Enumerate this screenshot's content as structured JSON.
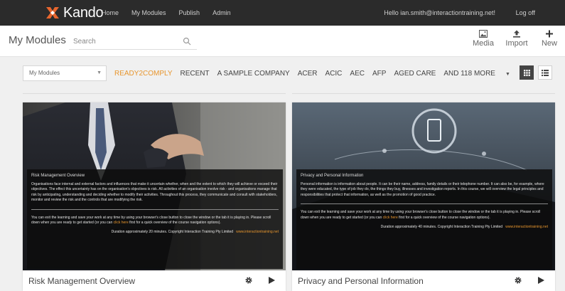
{
  "app": {
    "logo_text": "Kando",
    "nav": [
      "Home",
      "My Modules",
      "Publish",
      "Admin"
    ],
    "user_greeting": "Hello ian.smith@interactiontraining.net!",
    "logout": "Log off"
  },
  "header": {
    "title": "My Modules",
    "search_placeholder": "Search",
    "actions": [
      {
        "label": "Media",
        "icon": "image-icon"
      },
      {
        "label": "Import",
        "icon": "upload-icon"
      },
      {
        "label": "New",
        "icon": "plus-icon"
      }
    ]
  },
  "filters": {
    "dropdown_value": "My Modules",
    "tags": [
      "READY2COMPLY",
      "RECENT",
      "A SAMPLE COMPANY",
      "ACER",
      "ACIC",
      "AEC",
      "AFP",
      "AGED CARE",
      "AND 118 MORE"
    ],
    "active_tag": "READY2COMPLY",
    "active_color": "#e8962e",
    "views": [
      "grid-view-icon",
      "list-view-icon"
    ]
  },
  "cards": [
    {
      "title": "Risk Management Overview",
      "overlay_title": "Risk Management Overview",
      "description": "Organisations face internal and external factors and influences that make it uncertain whether, when and the extent to which they will achieve or exceed their objectives. The effect this uncertainty has on the organisation's objectives is risk. All activities of an organisation involve risk - and organisations manage that risk by anticipating, understanding and deciding whether to modify their activities. Throughout this process, they communicate and consult with stakeholders, monitor and review the risk and the controls that are modifying the risk.",
      "info_before": "You can exit the learning and save your work at any time by using your browser's close button to close the window or the tab it is playing in. Please scroll down when you are ready to get started (or you can ",
      "info_link": "click here",
      "info_after": " first for a quick overview of the course navigation options).",
      "duration": "Duration approximately 20 minutes. Copyright Interaction Training Pty Limited",
      "url": "www.interactiontraining.net"
    },
    {
      "title": "Privacy and Personal Information",
      "overlay_title": "Privacy and Personal Information",
      "description": "Personal information is information about people. It can be their name, address, family details or their telephone number. It can also be, for example, where they were educated, the type of job they do, the things they buy, illnesses and investigation reports. In this course, we will overview the legal principles and responsibilities that protect that information, as well as the promotion of good practice.",
      "info_before": "You can exit the learning and save your work at any time by using your browser's close button to close the window or the tab it is playing in. Please scroll down when you are ready to get started (or you can ",
      "info_link": "click here",
      "info_after": " first for a quick overview of the course navigation options).",
      "duration": "Duration approximately 40 minutes. Copyright Interaction Training Pty Limited",
      "url": "www.interactiontraining.net"
    }
  ]
}
